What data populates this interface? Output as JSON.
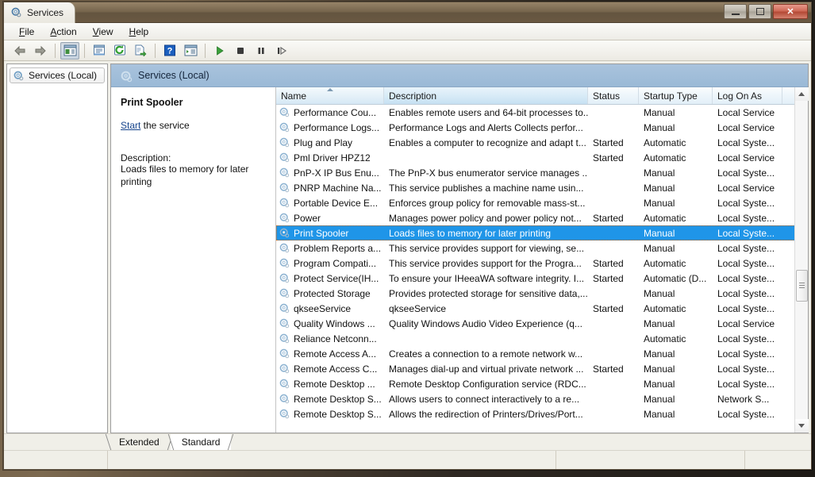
{
  "window": {
    "title": "Services",
    "title_icon": "services-gear-icon",
    "minimize_label": "Minimize",
    "maximize_label": "Maximize",
    "close_label": "Close"
  },
  "menubar": [
    {
      "label": "File",
      "accel": "F"
    },
    {
      "label": "Action",
      "accel": "A"
    },
    {
      "label": "View",
      "accel": "V"
    },
    {
      "label": "Help",
      "accel": "H"
    }
  ],
  "toolbar": [
    {
      "name": "back-icon",
      "label": "Back"
    },
    {
      "name": "forward-icon",
      "label": "Forward"
    },
    {
      "name": "show-hide-console-tree-icon",
      "label": "Show/Hide Console Tree",
      "pressed": true
    },
    {
      "name": "properties-icon",
      "label": "Properties"
    },
    {
      "name": "refresh-icon",
      "label": "Refresh"
    },
    {
      "name": "export-list-icon",
      "label": "Export List"
    },
    {
      "name": "help-icon",
      "label": "Help"
    },
    {
      "name": "show-action-pane-icon",
      "label": "Show Action Pane"
    },
    {
      "name": "start-service-icon",
      "label": "Start Service"
    },
    {
      "name": "stop-service-icon",
      "label": "Stop Service"
    },
    {
      "name": "pause-service-icon",
      "label": "Pause Service"
    },
    {
      "name": "restart-service-icon",
      "label": "Restart Service"
    }
  ],
  "tree": {
    "root_label": "Services (Local)",
    "root_icon": "services-gear-icon"
  },
  "pane": {
    "header_title": "Services (Local)",
    "header_icon": "services-gear-icon"
  },
  "details": {
    "service_name": "Print Spooler",
    "action_link": "Start",
    "action_suffix": " the service",
    "description_label": "Description:",
    "description": "Loads files to memory for later printing"
  },
  "list": {
    "columns": [
      {
        "key": "name",
        "label": "Name",
        "sorted": "asc"
      },
      {
        "key": "description",
        "label": "Description"
      },
      {
        "key": "status",
        "label": "Status"
      },
      {
        "key": "startup",
        "label": "Startup Type"
      },
      {
        "key": "logon",
        "label": "Log On As"
      }
    ],
    "rows": [
      {
        "name": "Performance Cou...",
        "description": "Enables remote users and 64-bit processes to...",
        "status": "",
        "startup": "Manual",
        "logon": "Local Service",
        "selected": false
      },
      {
        "name": "Performance Logs...",
        "description": "Performance Logs and Alerts Collects perfor...",
        "status": "",
        "startup": "Manual",
        "logon": "Local Service",
        "selected": false
      },
      {
        "name": "Plug and Play",
        "description": "Enables a computer to recognize and adapt t...",
        "status": "Started",
        "startup": "Automatic",
        "logon": "Local Syste...",
        "selected": false
      },
      {
        "name": "Pml Driver HPZ12",
        "description": "",
        "status": "Started",
        "startup": "Automatic",
        "logon": "Local Service",
        "selected": false
      },
      {
        "name": "PnP-X IP Bus Enu...",
        "description": "The PnP-X bus enumerator service manages ...",
        "status": "",
        "startup": "Manual",
        "logon": "Local Syste...",
        "selected": false
      },
      {
        "name": "PNRP Machine Na...",
        "description": "This service publishes a machine name usin...",
        "status": "",
        "startup": "Manual",
        "logon": "Local Service",
        "selected": false
      },
      {
        "name": "Portable Device E...",
        "description": "Enforces group policy for removable mass-st...",
        "status": "",
        "startup": "Manual",
        "logon": "Local Syste...",
        "selected": false
      },
      {
        "name": "Power",
        "description": "Manages power policy and power policy not...",
        "status": "Started",
        "startup": "Automatic",
        "logon": "Local Syste...",
        "selected": false
      },
      {
        "name": "Print Spooler",
        "description": "Loads files to memory for later printing",
        "status": "",
        "startup": "Manual",
        "logon": "Local Syste...",
        "selected": true
      },
      {
        "name": "Problem Reports a...",
        "description": "This service provides support for viewing, se...",
        "status": "",
        "startup": "Manual",
        "logon": "Local Syste...",
        "selected": false
      },
      {
        "name": "Program Compati...",
        "description": "This service provides support for the Progra...",
        "status": "Started",
        "startup": "Automatic",
        "logon": "Local Syste...",
        "selected": false
      },
      {
        "name": "Protect Service(IH...",
        "description": "To ensure your IHeeaWA software integrity. I...",
        "status": "Started",
        "startup": "Automatic (D...",
        "logon": "Local Syste...",
        "selected": false
      },
      {
        "name": "Protected Storage",
        "description": "Provides protected storage for sensitive data,...",
        "status": "",
        "startup": "Manual",
        "logon": "Local Syste...",
        "selected": false
      },
      {
        "name": "qkseeService",
        "description": "qkseeService",
        "status": "Started",
        "startup": "Automatic",
        "logon": "Local Syste...",
        "selected": false
      },
      {
        "name": "Quality Windows ...",
        "description": "Quality Windows Audio Video Experience (q...",
        "status": "",
        "startup": "Manual",
        "logon": "Local Service",
        "selected": false
      },
      {
        "name": "Reliance Netconn...",
        "description": "",
        "status": "",
        "startup": "Automatic",
        "logon": "Local Syste...",
        "selected": false
      },
      {
        "name": "Remote Access A...",
        "description": "Creates a connection to a remote network w...",
        "status": "",
        "startup": "Manual",
        "logon": "Local Syste...",
        "selected": false
      },
      {
        "name": "Remote Access C...",
        "description": "Manages dial-up and virtual private network ...",
        "status": "Started",
        "startup": "Manual",
        "logon": "Local Syste...",
        "selected": false
      },
      {
        "name": "Remote Desktop ...",
        "description": "Remote Desktop Configuration service (RDC...",
        "status": "",
        "startup": "Manual",
        "logon": "Local Syste...",
        "selected": false
      },
      {
        "name": "Remote Desktop S...",
        "description": "Allows users to connect interactively to a re...",
        "status": "",
        "startup": "Manual",
        "logon": "Network S...",
        "selected": false
      },
      {
        "name": "Remote Desktop S...",
        "description": "Allows the redirection of Printers/Drives/Port...",
        "status": "",
        "startup": "Manual",
        "logon": "Local Syste...",
        "selected": false
      }
    ]
  },
  "tabs": [
    {
      "label": "Extended",
      "active": false
    },
    {
      "label": "Standard",
      "active": true
    }
  ],
  "colors": {
    "selection": "#1f95e8",
    "focus_outline": "#c86a1d",
    "pane_header": "#9ab9d6",
    "link": "#16448c"
  }
}
